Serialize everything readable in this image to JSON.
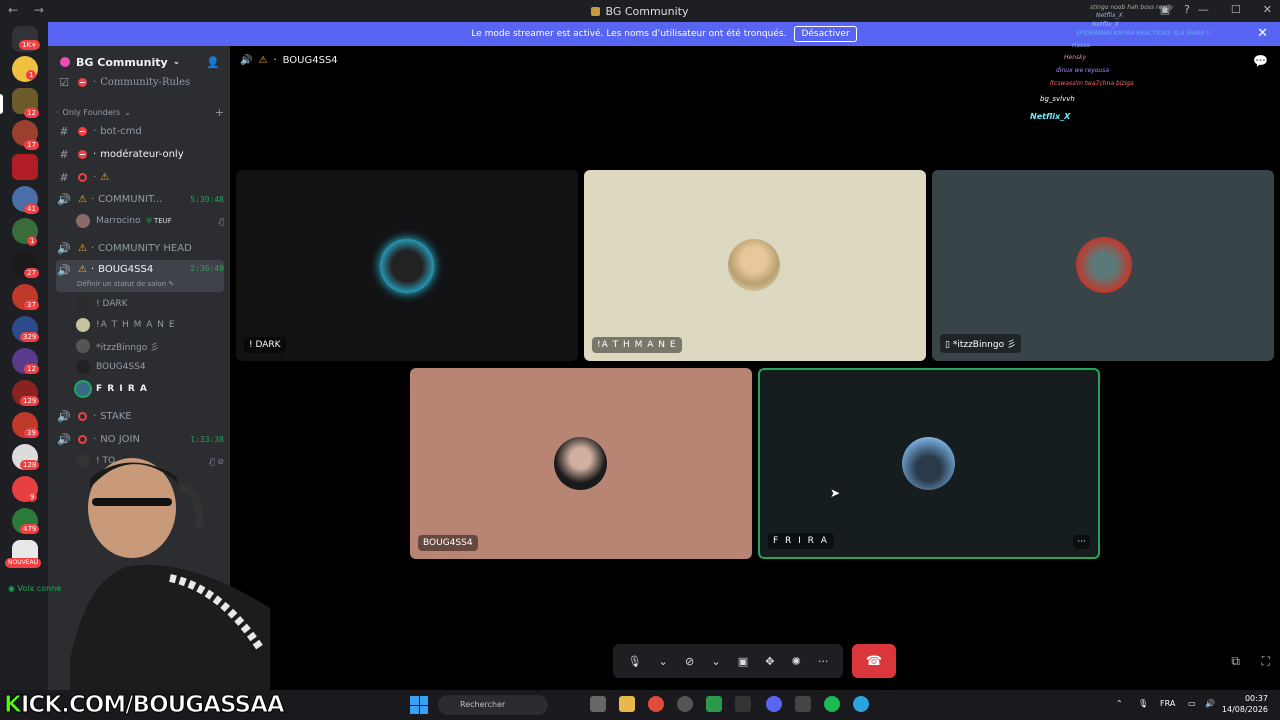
{
  "titlebar": {
    "title": "BG Community",
    "nav": "← →"
  },
  "banner": {
    "text": "Le mode streamer est activé. Les noms d’utilisateur ont été tronqués.",
    "button": "Désactiver"
  },
  "servers": {
    "top_badge": "1K+",
    "badges": [
      "1",
      "12",
      "17",
      "41",
      "1",
      "27",
      "37",
      "329",
      "12",
      "129",
      "39",
      "128",
      "9",
      "479"
    ],
    "new_label": "NOUVEAU"
  },
  "sidebar": {
    "server_name": "BG Community",
    "items": [
      {
        "label": "Community-Rules"
      },
      {
        "label": "Only Founders"
      },
      {
        "label": "bot-cmd"
      },
      {
        "label": "modérateur-only"
      },
      {
        "label": "⚠"
      },
      {
        "label": "COMMUNIT...",
        "time": "5:30:48"
      },
      {
        "label": "COMMUNITY HEAD"
      },
      {
        "label": "BOUG4SS4",
        "time": "2:36:49"
      },
      {
        "label": "STAKE"
      },
      {
        "label": "NO JOIN",
        "time": "1:33:38"
      }
    ],
    "member_marrocino": {
      "name": "Marrocino",
      "tag": "TEUF"
    },
    "status_hint": "Définir un statut de salon",
    "voice_members": [
      "! DARK",
      "!A T H M A N E",
      "*itzzBinngo 彡",
      "BOUG4SS4",
      "F R I R A"
    ],
    "no_join_member": "! TO",
    "voice_connected": "Voix conne"
  },
  "main": {
    "channel_title": "BOUG4SS4",
    "tiles": [
      {
        "name": "! DARK",
        "bg": "#121214"
      },
      {
        "name": "!A T H M A N E",
        "bg": "#dcd9c0"
      },
      {
        "name": "*itzzBinngo 彡",
        "bg": "#394448"
      },
      {
        "name": "BOUG4SS4",
        "bg": "#b88574"
      },
      {
        "name": "F R I R A",
        "bg": "#151d1f"
      }
    ]
  },
  "overlay_chat": [
    "stingo noob hah boss ready",
    "Netflix_X",
    "Netflix_X",
    "SPIDERMAN KAYMA REACTIONS SLA SHAW !!",
    "Hossa",
    "Hensky",
    "dinux we reyousa",
    "ltcswassim twa7chna biziga",
    "bg_svlvvh",
    "Netflix_X"
  ],
  "taskbar": {
    "kick_text": "KICK.COM/BOUGASSAA",
    "search_placeholder": "Rechercher",
    "lang": "FRA",
    "time": "00:37",
    "date": "14/08/2026"
  }
}
